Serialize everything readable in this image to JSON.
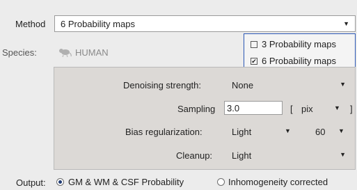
{
  "method": {
    "label": "Method",
    "value": "6 Probability maps"
  },
  "species": {
    "label": "Species:",
    "value": "HUMAN",
    "icon": "rat-icon"
  },
  "method_dropdown": {
    "options": [
      {
        "label": "3 Probability maps",
        "checked": false
      },
      {
        "label": "6 Probability maps",
        "checked": true
      }
    ]
  },
  "panel": {
    "denoising": {
      "label": "Denoising strength:",
      "value": "None"
    },
    "sampling": {
      "label": "Sampling",
      "value": "3.0",
      "bracket_open": "[",
      "unit": "pix",
      "bracket_close": "]"
    },
    "bias": {
      "label": "Bias regularization:",
      "value": "Light",
      "number": "60"
    },
    "cleanup": {
      "label": "Cleanup:",
      "value": "Light"
    }
  },
  "output": {
    "label": "Output:",
    "options": [
      {
        "label": "GM & WM & CSF Probability",
        "selected": true
      },
      {
        "label": "Inhomogeneity corrected",
        "selected": false
      }
    ]
  },
  "colors": {
    "accent": "#1f3b73",
    "popup_border": "#2a56b4",
    "panel_bg": "#dcd9d6"
  }
}
